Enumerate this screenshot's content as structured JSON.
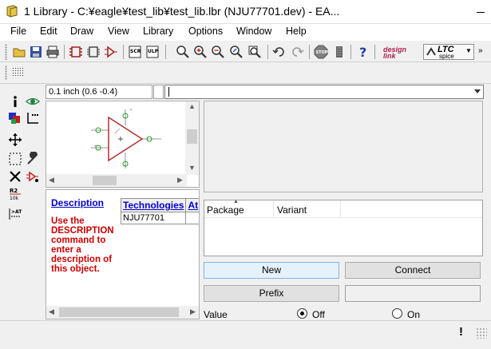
{
  "window": {
    "title": "1 Library - C:¥eagle¥test_lib¥test_lib.lbr (NJU77701.dev) - EA..."
  },
  "menu": [
    "File",
    "Edit",
    "Draw",
    "View",
    "Library",
    "Options",
    "Window",
    "Help"
  ],
  "toolbar": {
    "icons": [
      "open-icon",
      "save-icon",
      "print-icon",
      "package-icon",
      "symbol-icon",
      "device-icon",
      "script-icon",
      "ulp-icon",
      "zoom-fit-icon",
      "zoom-in-icon",
      "zoom-out-icon",
      "zoom-redraw-icon",
      "zoom-select-icon",
      "undo-icon",
      "redo-icon",
      "stop-icon",
      "go-icon",
      "help-icon"
    ],
    "designlink_label": "design link",
    "ltc_label": "LTC",
    "ltc_sub": "spice"
  },
  "grid_field": "0.1 inch (0.6 -0.4)",
  "command_line": "",
  "left_tools": [
    "info-icon",
    "show-icon",
    "display-icon",
    "mark-icon",
    "move-icon",
    "group-icon",
    "change-icon",
    "delete-icon",
    "add-icon",
    "name-icon",
    "value-icon",
    "smash-icon"
  ],
  "description": {
    "link": "Description",
    "text": "Use the DESCRIPTION command to enter a description of this object.",
    "tech_headers": [
      "Technologies",
      "At"
    ],
    "tech_rows": [
      "NJU77701"
    ]
  },
  "packages": {
    "headers": [
      "Package",
      "Variant"
    ]
  },
  "buttons": {
    "new": "New",
    "connect": "Connect",
    "prefix": "Prefix"
  },
  "prefix_value": "",
  "value_row": {
    "label": "Value",
    "off": "Off",
    "on": "On",
    "selected": "off"
  },
  "status": {
    "icon": "!"
  },
  "colors": {
    "symbol_outline": "#b03030",
    "pin_green": "#2a9a2a",
    "link_blue": "#0000cc",
    "desc_red": "#cc0000"
  }
}
